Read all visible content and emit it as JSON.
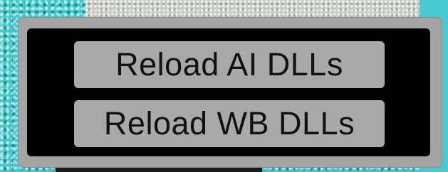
{
  "menu": {
    "buttons": [
      {
        "label": "Reload AI DLLs"
      },
      {
        "label": "Reload WB DLLs"
      }
    ]
  },
  "colors": {
    "panel": "#a4a4a4",
    "panel_inner": "#000000",
    "button": "#a9a9a9",
    "button_text": "#111111"
  }
}
